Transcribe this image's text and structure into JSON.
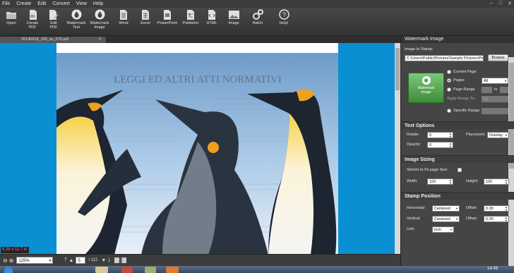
{
  "menu": [
    "File",
    "Create",
    "Edit",
    "Convert",
    "View",
    "Help"
  ],
  "window_controls": [
    "–",
    "□",
    "✕"
  ],
  "toolbar": [
    {
      "label": "Open",
      "icon": "folder-icon"
    },
    {
      "label": "Create\nPDF",
      "icon": "create-pdf-icon"
    },
    {
      "label": "Edit\nPDF",
      "icon": "edit-pdf-icon"
    },
    {
      "label": "Watermark\nText",
      "icon": "watermark-text-icon"
    },
    {
      "label": "Watermark\nImage",
      "icon": "watermark-image-icon"
    },
    {
      "label": "Word",
      "icon": "word-doc-icon"
    },
    {
      "label": "Excel",
      "icon": "excel-doc-icon"
    },
    {
      "label": "PowerPoint",
      "icon": "powerpoint-doc-icon"
    },
    {
      "label": "Publisher",
      "icon": "publisher-doc-icon"
    },
    {
      "label": "HTML",
      "icon": "html-doc-icon"
    },
    {
      "label": "Image",
      "icon": "image-icon"
    },
    {
      "label": "Batch",
      "icon": "gears-icon"
    },
    {
      "label": "Help!",
      "icon": "help-icon"
    }
  ],
  "document": {
    "tab_name": "20140918_190_so_070.pdf",
    "header_text": "LEGGI ED ALTRI ATTI NORMATIVI",
    "page_size": "8.26 x 11.7 in"
  },
  "status": {
    "zoom": "125%",
    "page": "5",
    "total": "/ 112"
  },
  "panel": {
    "title": "Watermark Image",
    "image_to_stamp_label": "Image to Stamp:",
    "image_path": "C:\\Users\\Public\\Pictures\\Sample Pictures\\Pe",
    "browse": "Browse",
    "stamp_button": "Watermark\nImage",
    "current_page": "Current Page",
    "pages": "Pages",
    "pages_value": "All",
    "page_range": "Page Range",
    "to": "to",
    "apply_range_to": "Apply Range To:",
    "apply_range_value": "All",
    "specific_range": "Specific Range:",
    "text_options": "Text Options",
    "rotate_label": "Rotate:",
    "rotate_value": "0",
    "placement_label": "Placement:",
    "placement_value": "Overlay",
    "opacity_label": "Opacity:",
    "opacity_value": "0",
    "image_sizing": "Image Sizing",
    "stretch_label": "Stretch to Fit page Size:",
    "width_label": "Width:",
    "width_value": "100",
    "height_label": "Height:",
    "height_value": "100",
    "stamp_position": "Stamp Position",
    "horizontal_label": "Horizontal:",
    "horizontal_value": "Centered",
    "h_offset_label": "Offset:",
    "h_offset_value": "0.00",
    "vertical_label": "Vertical:",
    "vertical_value": "Centered",
    "v_offset_label": "Offset:",
    "v_offset_value": "0.00",
    "unit_label": "Unit:",
    "unit_value": "inch"
  },
  "taskbar_time": "14:49"
}
